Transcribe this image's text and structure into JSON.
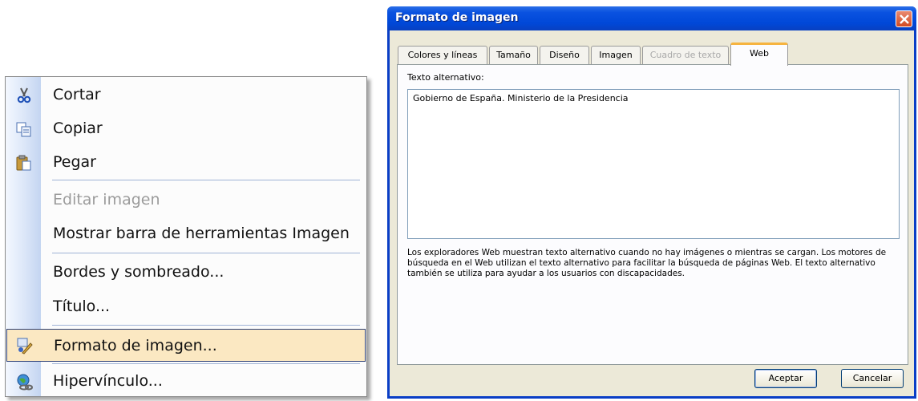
{
  "context_menu": {
    "items": [
      {
        "label": "Cortar",
        "icon": "scissors-icon",
        "enabled": true
      },
      {
        "label": "Copiar",
        "icon": "copy-icon",
        "enabled": true
      },
      {
        "label": "Pegar",
        "icon": "paste-icon",
        "enabled": true
      },
      {
        "label": "Editar imagen",
        "icon": null,
        "enabled": false
      },
      {
        "label": "Mostrar barra de herramientas Imagen",
        "icon": null,
        "enabled": true
      },
      {
        "label": "Bordes y sombreado...",
        "icon": null,
        "enabled": true
      },
      {
        "label": "Título...",
        "icon": null,
        "enabled": true
      },
      {
        "label": "Formato de imagen...",
        "icon": "format-picture-icon",
        "enabled": true,
        "highlighted": true
      },
      {
        "label": "Hipervínculo...",
        "icon": "hyperlink-globe-icon",
        "enabled": true
      }
    ]
  },
  "dialog": {
    "title": "Formato de imagen",
    "tabs": [
      {
        "label": "Colores y líneas",
        "enabled": true
      },
      {
        "label": "Tamaño",
        "enabled": true
      },
      {
        "label": "Diseño",
        "enabled": true
      },
      {
        "label": "Imagen",
        "enabled": true
      },
      {
        "label": "Cuadro de texto",
        "enabled": false
      },
      {
        "label": "Web",
        "enabled": true,
        "active": true
      }
    ],
    "field_label": "Texto alternativo:",
    "alt_text_value": "Gobierno de España. Ministerio de la Presidencia",
    "help_text": "Los exploradores Web muestran texto alternativo cuando no hay imágenes o mientras se cargan. Los motores de búsqueda en el Web utilizan el texto alternativo para facilitar la búsqueda de páginas Web. El texto alternativo también se utiliza para ayudar a los usuarios con discapacidades.",
    "ok_label": "Aceptar",
    "cancel_label": "Cancelar"
  },
  "colors": {
    "title_bar": "#0048d8",
    "menu_highlight": "#fbe8c2",
    "active_tab_accent": "#f6b440",
    "dialog_face": "#ece9d8"
  }
}
